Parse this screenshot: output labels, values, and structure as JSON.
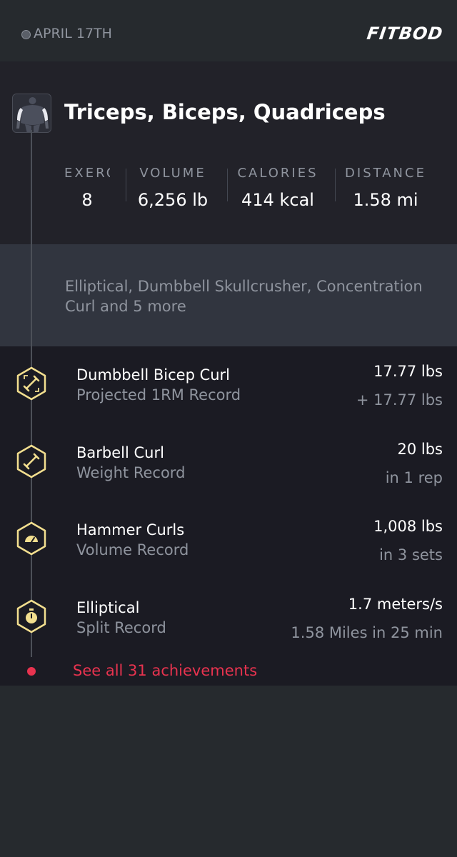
{
  "header": {
    "date": "APRIL 17TH",
    "logo": "FITBOD"
  },
  "workout": {
    "title": "Triceps, Biceps, Quadriceps",
    "avatar_icon": "muscle-body-icon",
    "stats": [
      {
        "label": "EXERCISES",
        "value": "8"
      },
      {
        "label": "VOLUME",
        "value": "6,256 lb"
      },
      {
        "label": "CALORIES",
        "value": "414 kcal"
      },
      {
        "label": "DISTANCE",
        "value": "1.58 mi"
      }
    ],
    "summary": "Elliptical, Dumbbell Skullcrusher, Concentration Curl and 5 more"
  },
  "achievements": [
    {
      "name": "Dumbbell Bicep Curl",
      "type": "Projected 1RM Record",
      "value": "17.77 lbs",
      "detail": "+ 17.77 lbs",
      "icon": "dumbbell-arrows-icon"
    },
    {
      "name": "Barbell Curl",
      "type": "Weight Record",
      "value": "20 lbs",
      "detail": "in 1 rep",
      "icon": "dumbbell-icon"
    },
    {
      "name": "Hammer Curls",
      "type": "Volume Record",
      "value": "1,008 lbs",
      "detail": "in 3 sets",
      "icon": "gauge-icon"
    },
    {
      "name": "Elliptical",
      "type": "Split Record",
      "value": "1.7 meters/s",
      "detail": "1.58 Miles in 25 min",
      "icon": "stopwatch-icon"
    }
  ],
  "see_all": "See all 31 achievements",
  "colors": {
    "accent": "#e8334f",
    "badge": "#f3df8f",
    "background": "#262a2e"
  }
}
